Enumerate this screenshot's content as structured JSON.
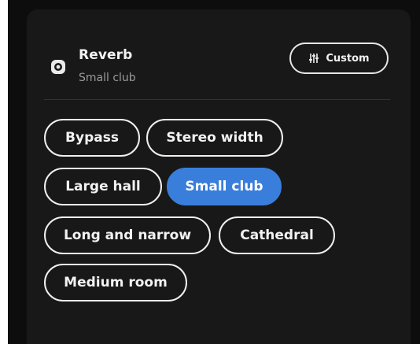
{
  "header": {
    "title": "Reverb",
    "subtitle": "Small club",
    "icon": "reverb-speaker-icon",
    "custom_button": {
      "label": "Custom",
      "icon": "equalizer-sliders-icon"
    }
  },
  "presets": [
    {
      "label": "Bypass",
      "selected": false
    },
    {
      "label": "Stereo width",
      "selected": false
    },
    {
      "label": "Large hall",
      "selected": false
    },
    {
      "label": "Small club",
      "selected": true
    },
    {
      "label": "Long and narrow",
      "selected": false
    },
    {
      "label": "Cathedral",
      "selected": false
    },
    {
      "label": "Medium room",
      "selected": false
    }
  ],
  "colors": {
    "background": "#0d0d0d",
    "panel": "#181818",
    "accent": "#3a7edb",
    "text": "#f2f2f2",
    "muted_text": "#9a9a9a"
  }
}
